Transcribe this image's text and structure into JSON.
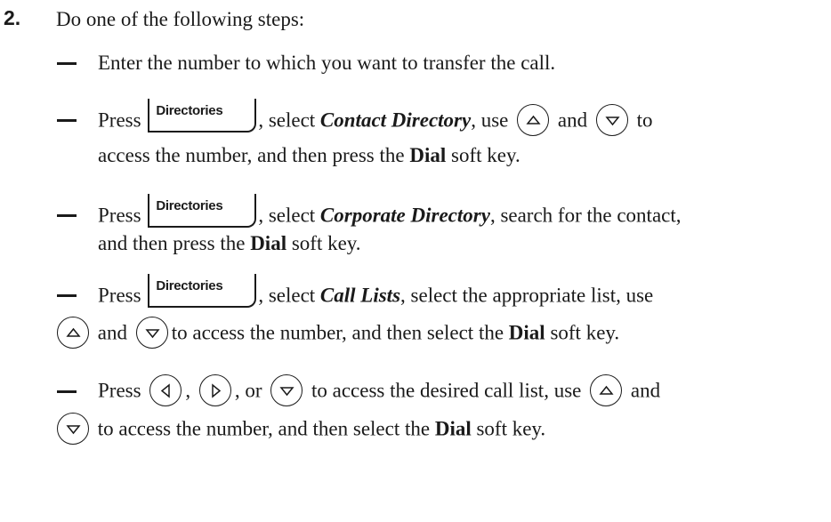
{
  "step": {
    "number": "2.",
    "intro": "Do one of the following steps:"
  },
  "items": {
    "enter": "Enter the number to which you want to transfer the call.",
    "contact": {
      "press": "Press",
      "softkey": "Directories",
      "select": ", select ",
      "target": "Contact Directory",
      "use": ", use",
      "and": "and",
      "to": "to",
      "line2_a": "access the number, and then press the ",
      "dial": "Dial",
      "line2_b": " soft key."
    },
    "corporate": {
      "press": "Press",
      "softkey": "Directories",
      "select": ", select ",
      "target": "Corporate Directory",
      "rest": ", search for the contact,",
      "line2_a": "and then press the ",
      "dial": "Dial",
      "line2_b": " soft key."
    },
    "calllists": {
      "press": "Press",
      "softkey": "Directories",
      "select": ", select ",
      "target": "Call Lists",
      "rest": ", select the appropriate list, use",
      "and": "and",
      "line2_a": "to access the number, and then select the ",
      "dial": "Dial",
      "line2_b": " soft key."
    },
    "navigate": {
      "press": "Press",
      "comma1": ",",
      "or": ", or",
      "rest": "to access the desired call list, use",
      "and": "and",
      "line2_a": "to access the number, and then select the ",
      "dial": "Dial",
      "line2_b": " soft key."
    }
  },
  "icons": {
    "softkey": "directories-softkey-icon",
    "up": "up-arrow-key-icon",
    "down": "down-arrow-key-icon",
    "left": "left-arrow-key-icon",
    "right": "right-arrow-key-icon"
  }
}
